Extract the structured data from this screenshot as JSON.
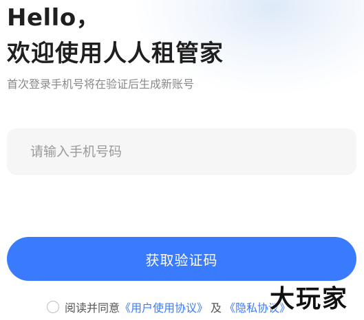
{
  "header": {
    "greeting": "Hello，",
    "title": "欢迎使用人人租管家",
    "subtitle": "首次登录手机号将在验证后生成新账号"
  },
  "form": {
    "phone_placeholder": "请输入手机号码",
    "phone_value": "",
    "submit_label": "获取验证码"
  },
  "agreement": {
    "checked": false,
    "prefix": "阅读并同意",
    "user_agreement_label": "《用户使用协议》",
    "conjunction": "及",
    "privacy_label": "《隐私协议》"
  },
  "watermark": {
    "text": "大玩家"
  },
  "colors": {
    "accent": "#3a7bfd",
    "input_background": "#f6f6f6",
    "subtitle_text": "#888888"
  }
}
